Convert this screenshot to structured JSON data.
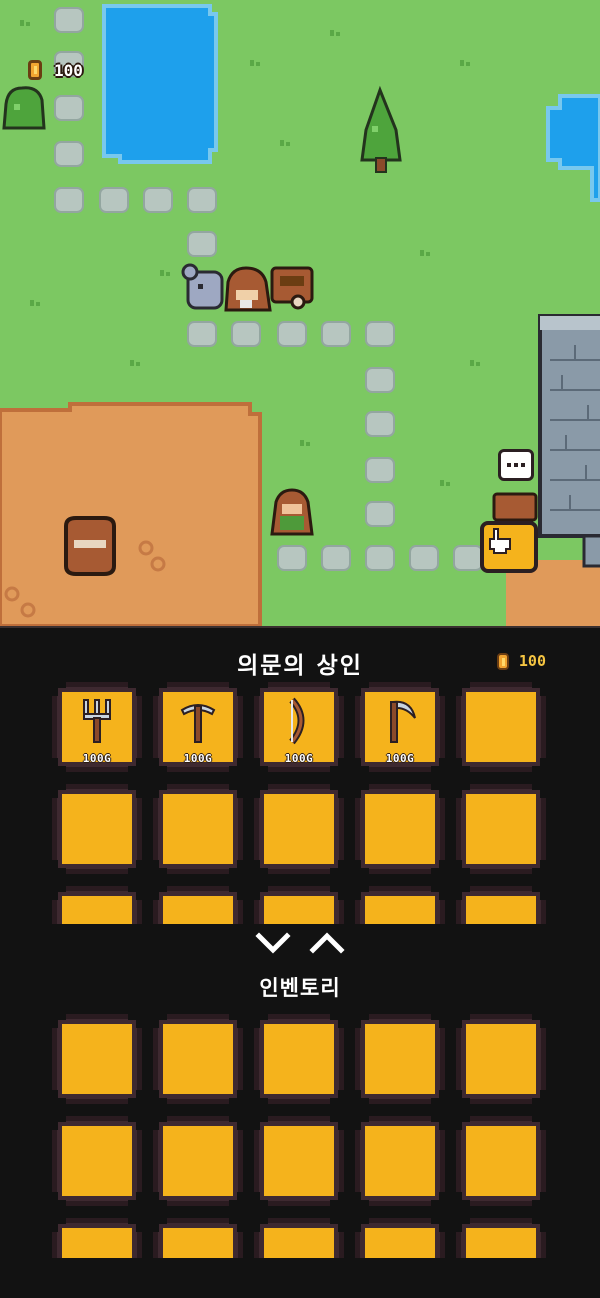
{
  "hud": {
    "coins": "100",
    "coin_icon": "coin-icon"
  },
  "world": {
    "npcs": [
      "mouse-npc",
      "merchant-npc",
      "cart-npc"
    ],
    "player": "player-character",
    "speech_icon": "speech-bubble-icon",
    "interact_icon": "pointing-hand-icon"
  },
  "shop": {
    "title": "의문의 상인",
    "coins": "100",
    "items": [
      {
        "icon": "pitchfork-icon",
        "price": "100G"
      },
      {
        "icon": "pickaxe-icon",
        "price": "100G"
      },
      {
        "icon": "bow-icon",
        "price": "100G"
      },
      {
        "icon": "scythe-icon",
        "price": "100G"
      }
    ],
    "slot_count": 15
  },
  "controls": {
    "down_icon": "chevron-down-icon",
    "up_icon": "chevron-up-icon"
  },
  "inventory": {
    "title": "인벤토리",
    "slot_count": 15
  },
  "colors": {
    "grass": "#7cc862",
    "water": "#1ea0ec",
    "dirt": "#e09a5a",
    "slot_fill": "#f5b31c",
    "slot_border": "#3e2930",
    "panel_bg": "#121212",
    "coin_text": "#f5c542"
  }
}
